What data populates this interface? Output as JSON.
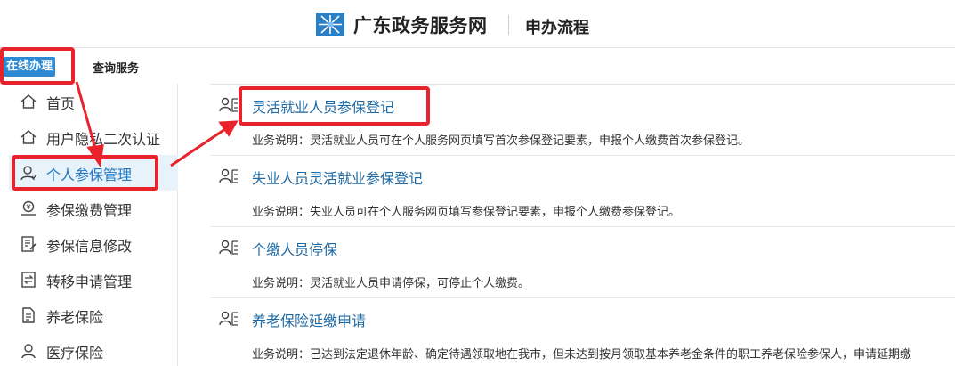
{
  "header": {
    "site_title": "广东政务服务网",
    "subtitle": "申办流程"
  },
  "tabs": {
    "online": "在线办理",
    "query": "查询服务"
  },
  "sidebar": {
    "items": [
      {
        "label": "首页",
        "icon": "home-icon"
      },
      {
        "label": "用户隐私二次认证",
        "icon": "home-icon"
      },
      {
        "label": "个人参保管理",
        "icon": "person-icon",
        "active": true
      },
      {
        "label": "参保缴费管理",
        "icon": "payment-icon"
      },
      {
        "label": "参保信息修改",
        "icon": "edit-document-icon"
      },
      {
        "label": "转移申请管理",
        "icon": "transfer-icon"
      },
      {
        "label": "养老保险",
        "icon": "document-icon"
      },
      {
        "label": "医疗保险",
        "icon": "person-icon"
      }
    ]
  },
  "services": [
    {
      "title": "灵活就业人员参保登记",
      "desc": "业务说明：灵活就业人员可在个人服务网页填写首次参保登记要素，申报个人缴费首次参保登记。"
    },
    {
      "title": "失业人员灵活就业参保登记",
      "desc": "业务说明：失业人员可在个人服务网页填写参保登记要素，申报个人缴费参保登记。"
    },
    {
      "title": "个缴人员停保",
      "desc": "业务说明：灵活就业人员申请停保，可停止个人缴费。"
    },
    {
      "title": "养老保险延缴申请",
      "desc": "业务说明：已达到法定退休年龄、确定待遇领取地在我市，但未达到按月领取基本养老金条件的职工养老保险参保人，申请延期缴"
    }
  ],
  "colors": {
    "accent": "#2d8ad2",
    "link": "#1f6aa5",
    "annotation": "#e8232b"
  }
}
